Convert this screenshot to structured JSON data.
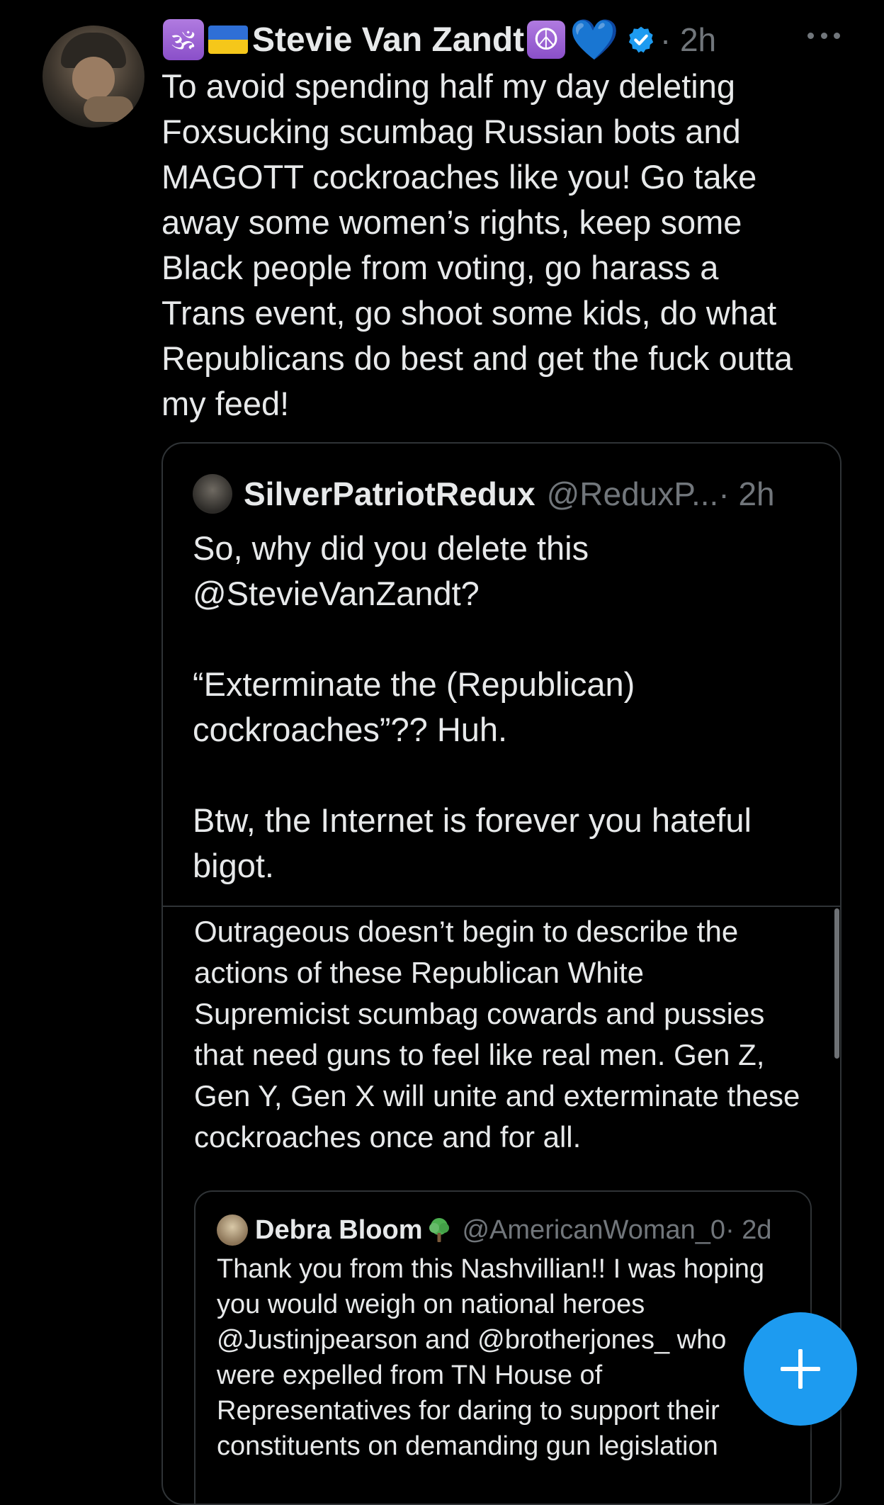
{
  "tweet": {
    "author_emoji_prefix": "🕉",
    "author_name": "Stevie Van Zandt",
    "author_emoji_suffix": "☮",
    "heart_emoji": "💙",
    "time": "· 2h",
    "text": "To avoid spending half my day deleting\nFoxsucking scumbag Russian bots and\nMAGOTT cockroaches like you! Go take\naway some women’s rights, keep some\nBlack people from voting, go harass a\nTrans event, go shoot some kids, do what\nRepublicans do best and get the fuck outta\nmy feed!"
  },
  "quote": {
    "name": "SilverPatriotRedux",
    "handle": "@ReduxP...",
    "time": "· 2h",
    "text": "So, why did you delete this\n@StevieVanZandt?\n\n“Exterminate the (Republican)\ncockroaches”??  Huh.\n\nBtw, the Internet is forever you hateful\nbigot.",
    "embedded_text": "Outrageous doesn’t begin to describe the\nactions of these Republican White\nSupremicist scumbag cowards and pussies\nthat need guns to feel like real men. Gen Z,\nGen Y, Gen X will unite and exterminate these\ncockroaches once and for all."
  },
  "inner_quote": {
    "name": "Debra Bloom",
    "handle": "@AmericanWoman_0",
    "time": "· 2d",
    "text": "Thank you from this Nashvillian!! I was hoping\nyou would weigh on national heroes\n@Justinjpearson and @brotherjones_  who\nwere expelled from TN House of\nRepresentatives for daring to support their\nconstituents on demanding gun legislation"
  },
  "colors": {
    "background": "#000000",
    "text": "#e7e9ea",
    "muted": "#71767b",
    "border": "#2f3336",
    "accent": "#1d9bf0"
  },
  "icons": [
    "avatar",
    "om-badge",
    "ukraine-flag",
    "peace-badge",
    "blue-heart",
    "verified-badge-icon",
    "more-options-icon",
    "tree-icon",
    "compose-plus-icon"
  ]
}
